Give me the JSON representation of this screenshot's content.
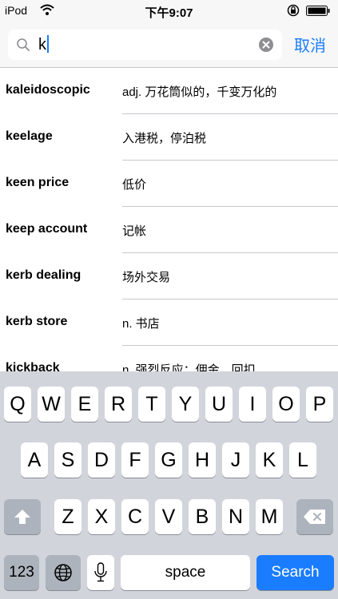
{
  "status_bar": {
    "carrier": "iPod",
    "time": "下午9:07"
  },
  "search": {
    "query": "k",
    "cancel_label": "取消"
  },
  "results": [
    {
      "term": "kaleidoscopic",
      "definition": "adj. 万花筒似的，千变万化的"
    },
    {
      "term": "keelage",
      "definition": "入港税，停泊税"
    },
    {
      "term": "keen price",
      "definition": "低价"
    },
    {
      "term": "keep account",
      "definition": "记帐"
    },
    {
      "term": "kerb dealing",
      "definition": "场外交易"
    },
    {
      "term": "kerb store",
      "definition": "n. 书店"
    },
    {
      "term": "kickback",
      "definition": "n. 强烈反应；佣金，回扣"
    }
  ],
  "keyboard": {
    "row1": [
      "Q",
      "W",
      "E",
      "R",
      "T",
      "Y",
      "U",
      "I",
      "O",
      "P"
    ],
    "row2": [
      "A",
      "S",
      "D",
      "F",
      "G",
      "H",
      "J",
      "K",
      "L"
    ],
    "row3": [
      "Z",
      "X",
      "C",
      "V",
      "B",
      "N",
      "M"
    ],
    "numbers_label": "123",
    "space_label": "space",
    "search_label": "Search"
  },
  "colors": {
    "accent": "#1a7cff",
    "keyboard_bg": "#d1d5db",
    "func_key": "#adb3bc"
  }
}
